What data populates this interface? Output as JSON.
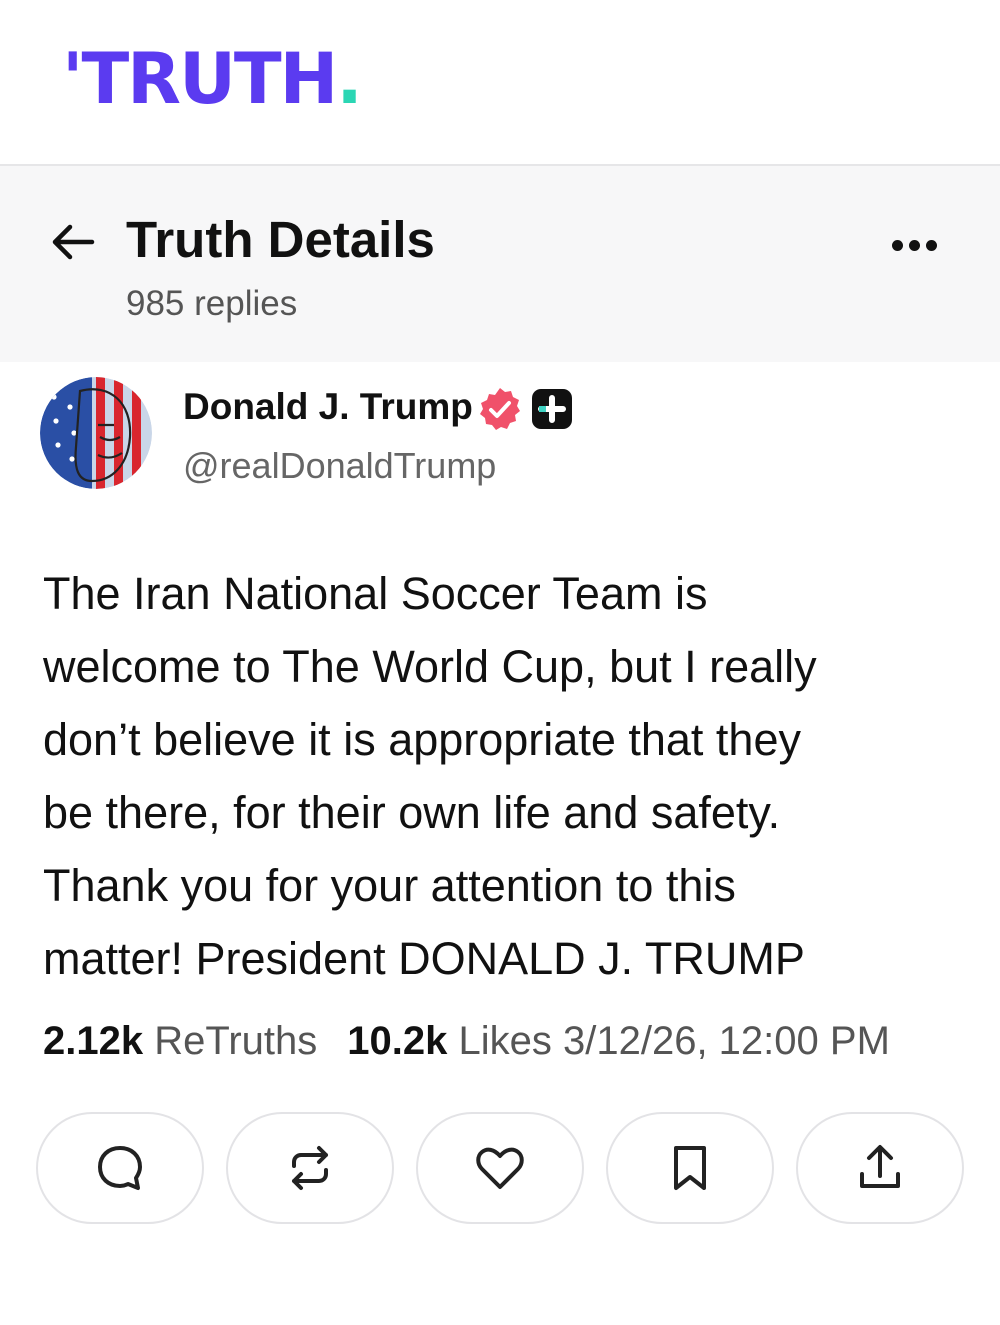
{
  "brand": {
    "logo_mark": "'",
    "logo_text": "TRUTH",
    "logo_dot": ".",
    "primary_color": "#5b3bf0",
    "accent_color": "#2bd6b4"
  },
  "header": {
    "title": "Truth Details",
    "replies": "985 replies",
    "back_icon": "arrow-left-icon",
    "menu_icon": "more-horizontal-icon"
  },
  "author": {
    "name": "Donald J. Trump",
    "handle": "@realDonaldTrump",
    "verified_icon": "verified-badge-icon",
    "badge_icon": "plus-badge-icon",
    "verified_color": "#f0516a"
  },
  "post": {
    "text": "The Iran National Soccer Team is\nwelcome to The World Cup, but I really\ndon’t believe it is appropriate that they\nbe there, for their own life and safety.\nThank you for your attention to this\nmatter! President DONALD J. TRUMP"
  },
  "stats": {
    "retruths_count": "2.12k",
    "retruths_label": "ReTruths",
    "likes_count": "10.2k",
    "likes_label": "Likes",
    "timestamp": "3/12/26, 12:00 PM"
  },
  "actions": [
    {
      "icon": "reply-icon"
    },
    {
      "icon": "retruth-icon"
    },
    {
      "icon": "like-icon"
    },
    {
      "icon": "bookmark-icon"
    },
    {
      "icon": "share-icon"
    }
  ]
}
